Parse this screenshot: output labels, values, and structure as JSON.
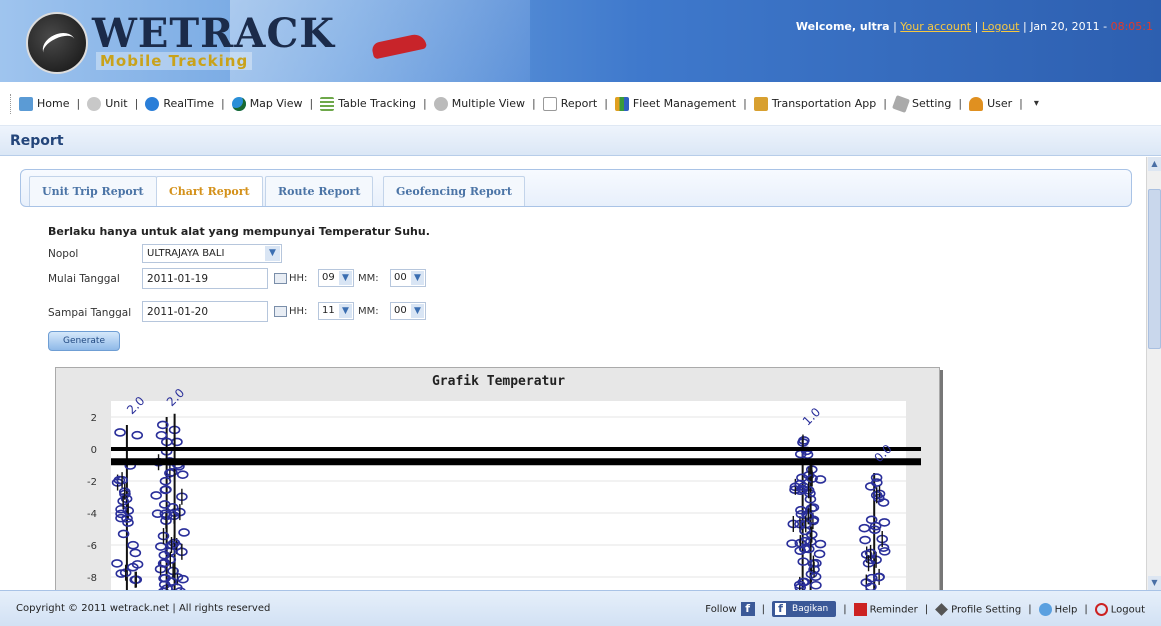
{
  "brand": {
    "logo_text": "WETRACK",
    "logo_subtitle": "Mobile Tracking"
  },
  "welcome": {
    "greeting": "Welcome, ultra",
    "your_account": "Your account",
    "logout": "Logout",
    "date": "Jan 20, 2011 -",
    "time": "08:05:1"
  },
  "menu": {
    "items": [
      {
        "label": "Home",
        "icon": "home-icon"
      },
      {
        "label": "Unit",
        "icon": "unit-icon"
      },
      {
        "label": "RealTime",
        "icon": "realtime-icon"
      },
      {
        "label": "Map View",
        "icon": "globe-icon"
      },
      {
        "label": "Table Tracking",
        "icon": "table-icon"
      },
      {
        "label": "Multiple View",
        "icon": "multiple-view-icon"
      },
      {
        "label": "Report",
        "icon": "document-icon"
      },
      {
        "label": "Fleet Management",
        "icon": "fleet-icon"
      },
      {
        "label": "Transportation App",
        "icon": "transport-icon"
      },
      {
        "label": "Setting",
        "icon": "settings-icon"
      },
      {
        "label": "User",
        "icon": "user-icon"
      }
    ]
  },
  "page": {
    "title": "Report"
  },
  "tabs": [
    {
      "label": "Unit Trip Report",
      "active": false
    },
    {
      "label": "Chart Report",
      "active": true
    },
    {
      "label": "Route Report",
      "active": false
    },
    {
      "label": "Geofencing Report",
      "active": false
    }
  ],
  "form": {
    "note": "Berlaku hanya untuk alat yang mempunyai Temperatur Suhu.",
    "nopol_label": "Nopol",
    "nopol_value": "ULTRAJAYA BALI",
    "start_label": "Mulai Tanggal",
    "start_date": "2011-01-19",
    "start_hh": "09",
    "start_mm": "00",
    "end_label": "Sampai Tanggal",
    "end_date": "2011-01-20",
    "end_hh": "11",
    "end_mm": "00",
    "hh_label": "HH:",
    "mm_label": "MM:",
    "generate_label": "Generate"
  },
  "chart_data": {
    "type": "scatter",
    "title": "Grafik Temperatur",
    "y_ticks": [
      "2",
      "0",
      "-2",
      "-4",
      "-6",
      "-8"
    ],
    "ylim": [
      -9,
      3
    ],
    "reference_lines": [
      0,
      -0.8
    ],
    "point_labels": [
      "2.0",
      "2.0",
      "1.0",
      "0.0"
    ],
    "clusters": [
      {
        "x": 0.02,
        "min": -9,
        "max": 1.5
      },
      {
        "x": 0.07,
        "min": -9,
        "max": 2
      },
      {
        "x": 0.08,
        "min": -9,
        "max": 2.2
      },
      {
        "x": 0.87,
        "min": -9,
        "max": 0.8
      },
      {
        "x": 0.88,
        "min": -9,
        "max": -1
      },
      {
        "x": 0.96,
        "min": -9,
        "max": -1.5
      }
    ]
  },
  "footer": {
    "copyright": "Copyright © 2011 wetrack.net | All rights reserved",
    "follow": "Follow",
    "share": "Bagikan",
    "reminder": "Reminder",
    "profile_setting": "Profile Setting",
    "help": "Help",
    "logout": "Logout"
  }
}
